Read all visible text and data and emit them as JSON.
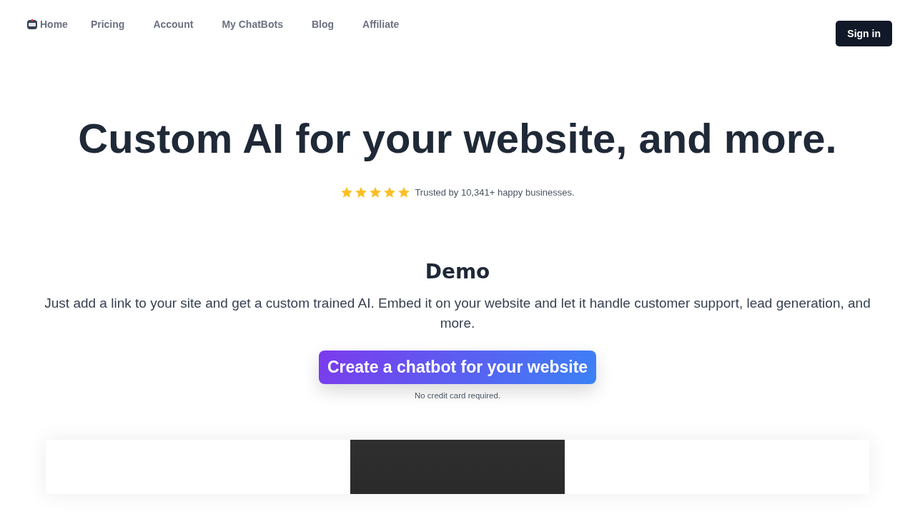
{
  "nav": {
    "items": [
      {
        "label": "Home"
      },
      {
        "label": "Pricing"
      },
      {
        "label": "Account"
      },
      {
        "label": "My ChatBots"
      },
      {
        "label": "Blog"
      },
      {
        "label": "Affiliate"
      }
    ],
    "sign_in": "Sign in"
  },
  "hero": {
    "title": "Custom AI for your website, and more.",
    "stars": 5,
    "trust": "Trusted by 10,341+ happy businesses."
  },
  "demo": {
    "title": "Demo",
    "text": "Just add a link to your site and get a custom trained AI. Embed it on your website and let it handle customer support, lead generation, and more.",
    "cta": "Create a chatbot for your website",
    "note": "No credit card required."
  }
}
